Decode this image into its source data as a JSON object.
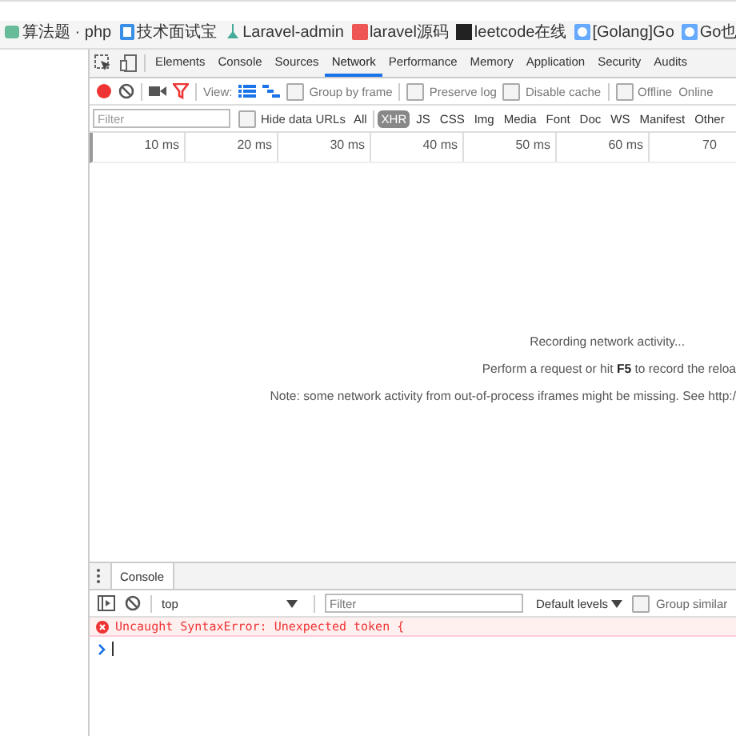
{
  "bookmarks": [
    {
      "label": "算法题 · php"
    },
    {
      "label": "技术面试宝"
    },
    {
      "label": "Laravel-admin"
    },
    {
      "label": "laravel源码"
    },
    {
      "label": "leetcode在线"
    },
    {
      "label": "[Golang]Go"
    },
    {
      "label": "Go也"
    }
  ],
  "devtools_tabs": [
    {
      "label": "Elements",
      "selected": false
    },
    {
      "label": "Console",
      "selected": false
    },
    {
      "label": "Sources",
      "selected": false
    },
    {
      "label": "Network",
      "selected": true
    },
    {
      "label": "Performance",
      "selected": false
    },
    {
      "label": "Memory",
      "selected": false
    },
    {
      "label": "Application",
      "selected": false
    },
    {
      "label": "Security",
      "selected": false
    },
    {
      "label": "Audits",
      "selected": false
    }
  ],
  "network_toolbar": {
    "recording": true,
    "view_label": "View:",
    "options": [
      {
        "label": "Group by frame",
        "checked": false
      },
      {
        "label": "Preserve log",
        "checked": false
      },
      {
        "label": "Disable cache",
        "checked": false
      },
      {
        "label": "Offline",
        "checked": false
      }
    ],
    "throttling": "Online"
  },
  "filter_bar": {
    "placeholder": "Filter",
    "hide_data_urls": {
      "label": "Hide data URLs",
      "checked": false
    },
    "types": [
      {
        "label": "All",
        "selected": false
      },
      {
        "label": "XHR",
        "selected": true
      },
      {
        "label": "JS",
        "selected": false
      },
      {
        "label": "CSS",
        "selected": false
      },
      {
        "label": "Img",
        "selected": false
      },
      {
        "label": "Media",
        "selected": false
      },
      {
        "label": "Font",
        "selected": false
      },
      {
        "label": "Doc",
        "selected": false
      },
      {
        "label": "WS",
        "selected": false
      },
      {
        "label": "Manifest",
        "selected": false
      },
      {
        "label": "Other",
        "selected": false
      }
    ]
  },
  "timeline": {
    "ticks": [
      "10 ms",
      "20 ms",
      "30 ms",
      "40 ms",
      "50 ms",
      "60 ms",
      "70"
    ]
  },
  "empty_message": {
    "title": "Recording network activity...",
    "hint": "Perform a request or hit **F5** to record the reloa",
    "note": "Note: some network activity from out-of-process iframes might be missing. See http:/"
  },
  "drawer": {
    "tabs": [
      {
        "label": "Console",
        "selected": true
      }
    ],
    "context": "top",
    "filter_placeholder": "Filter",
    "levels": "Default levels",
    "group_similar": {
      "label": "Group similar",
      "checked": false
    },
    "messages": [
      {
        "kind": "error",
        "text": "Uncaught SyntaxError: Unexpected token {"
      }
    ]
  }
}
